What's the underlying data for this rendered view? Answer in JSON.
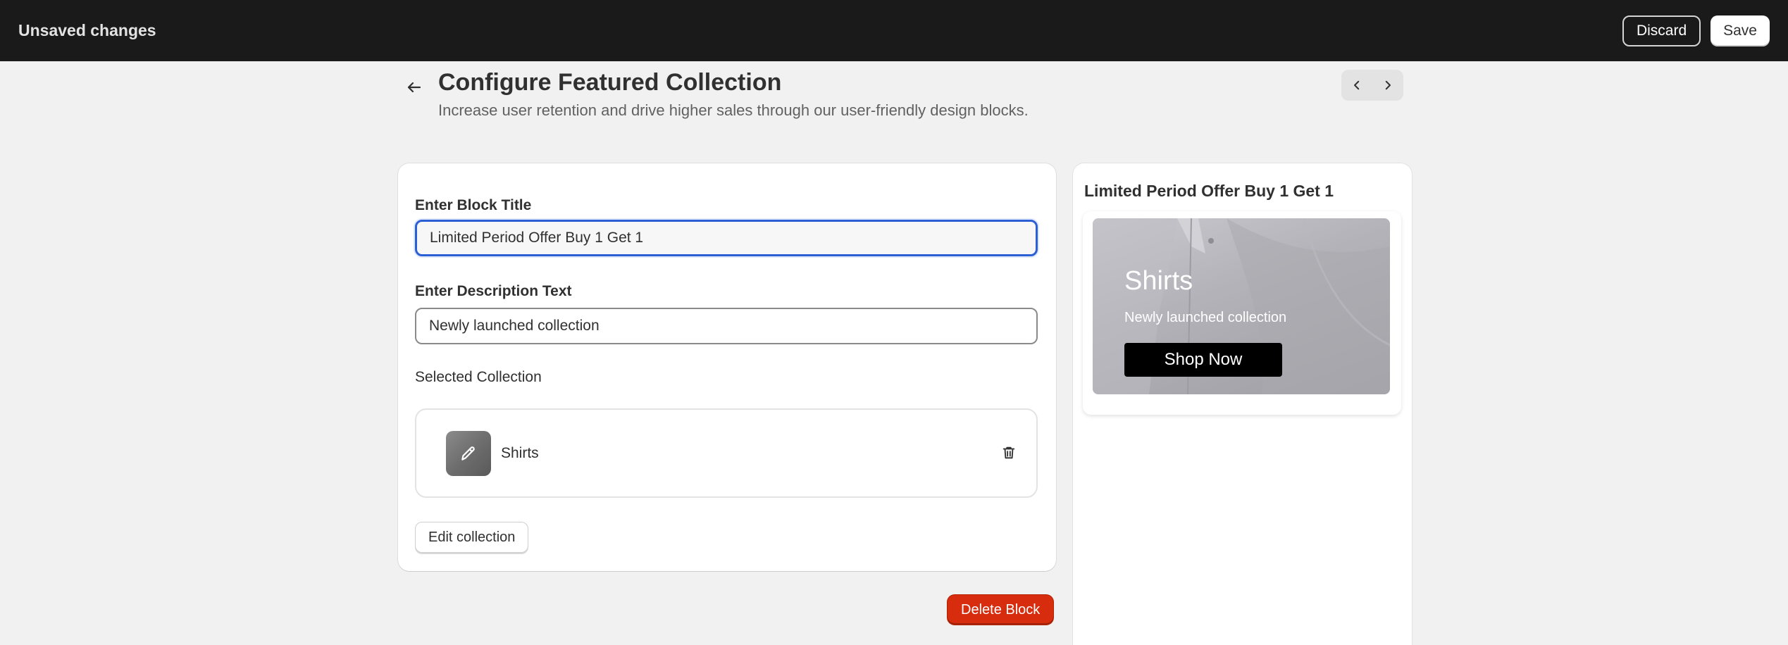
{
  "topbar": {
    "title": "Unsaved changes",
    "discard_label": "Discard",
    "save_label": "Save"
  },
  "header": {
    "title": "Configure Featured Collection",
    "subtitle": "Increase user retention and drive higher sales through our user-friendly design blocks."
  },
  "form": {
    "block_title_label": "Enter Block Title",
    "block_title_value": "Limited Period Offer Buy 1 Get 1",
    "description_label": "Enter Description Text",
    "description_value": "Newly launched collection",
    "selected_collection_label": "Selected Collection",
    "collection_name": "Shirts",
    "edit_collection_label": "Edit collection",
    "delete_block_label": "Delete Block"
  },
  "preview": {
    "title": "Limited Period Offer Buy 1 Get 1",
    "banner_heading": "Shirts",
    "banner_description": "Newly launched collection",
    "banner_button": "Shop Now"
  },
  "icons": {
    "back": "arrow-left-icon",
    "prev": "chevron-left-icon",
    "next": "chevron-right-icon",
    "edit": "pencil-icon",
    "delete": "trash-icon"
  },
  "colors": {
    "topbar": "#1a1a1a",
    "focus": "#2c5fd4",
    "danger": "#d72c0d"
  }
}
